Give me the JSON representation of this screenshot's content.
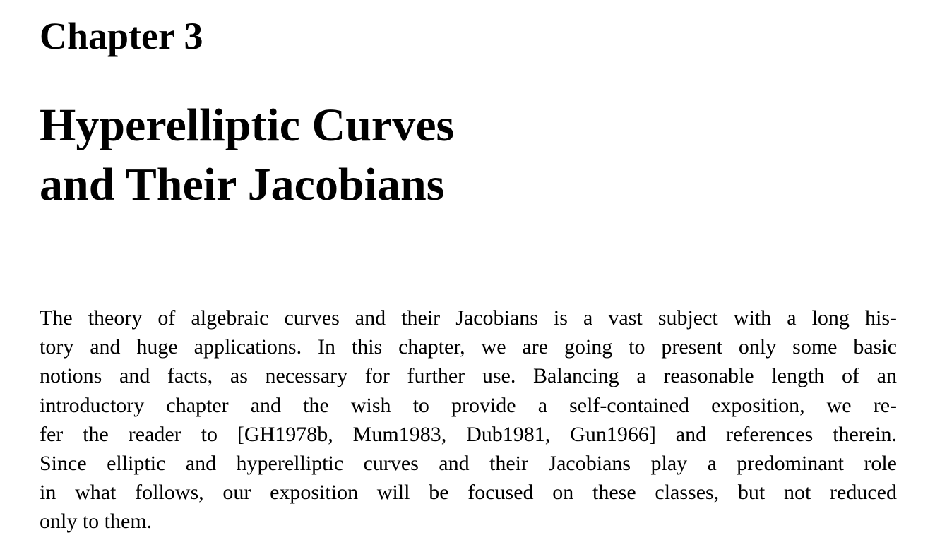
{
  "chapter": {
    "label": "Chapter 3",
    "title_lines": [
      "Hyperelliptic Curves",
      "and Their Jacobians"
    ]
  },
  "intro": {
    "lines": [
      "The theory of algebraic curves and their Jacobians is a vast subject with a long his-",
      "tory and huge applications. In this chapter, we are going to present only some basic",
      "notions and facts, as necessary for further use. Balancing a reasonable length of an",
      "introductory chapter and the wish to provide a self-contained exposition, we re-",
      "fer the reader to [GH1978b, Mum1983, Dub1981, Gun1966] and references therein.",
      "Since elliptic and hyperelliptic curves and their Jacobians play a predominant role",
      "in what follows, our exposition will be focused on these classes, but not reduced",
      "only to them."
    ]
  }
}
